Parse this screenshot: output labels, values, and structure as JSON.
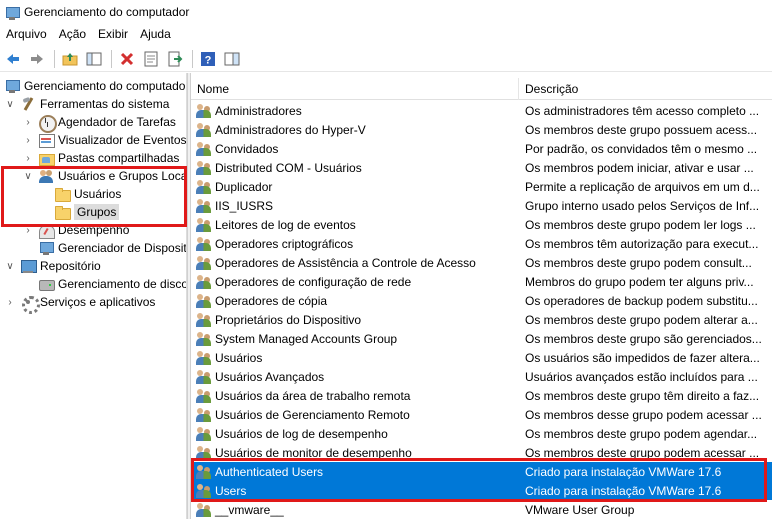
{
  "window": {
    "title": "Gerenciamento do computador"
  },
  "menu": [
    "Arquivo",
    "Ação",
    "Exibir",
    "Ajuda"
  ],
  "toolbar": {
    "buttons": [
      "back-arrow-icon",
      "forward-arrow-icon",
      "up-folder-icon",
      "show-hide-tree-icon",
      "delete-icon",
      "properties-icon",
      "export-list-icon",
      "help-icon",
      "console-view-icon"
    ]
  },
  "tree": {
    "root": "Gerenciamento do computador",
    "system_tools": "Ferramentas do sistema",
    "task_scheduler": "Agendador de Tarefas",
    "event_viewer": "Visualizador de Eventos",
    "shared_folders": "Pastas compartilhadas",
    "local_users_groups": "Usuários e Grupos Loca",
    "users": "Usuários",
    "groups": "Grupos",
    "performance": "Desempenho",
    "device_manager": "Gerenciador de Disposit",
    "storage": "Repositório",
    "disk_management": "Gerenciamento de disco",
    "services_apps": "Serviços e aplicativos"
  },
  "list": {
    "columns": {
      "name": "Nome",
      "description": "Descrição"
    },
    "rows": [
      {
        "name": "Administradores",
        "desc": "Os administradores têm acesso completo ..."
      },
      {
        "name": "Administradores do Hyper-V",
        "desc": "Os membros deste grupo possuem acess..."
      },
      {
        "name": "Convidados",
        "desc": "Por padrão, os convidados têm o mesmo ..."
      },
      {
        "name": "Distributed COM - Usuários",
        "desc": "Os membros podem iniciar, ativar e usar ..."
      },
      {
        "name": "Duplicador",
        "desc": "Permite a replicação de arquivos em um d..."
      },
      {
        "name": "IIS_IUSRS",
        "desc": "Grupo interno usado pelos Serviços de Inf..."
      },
      {
        "name": "Leitores de log de eventos",
        "desc": "Os membros deste grupo podem ler logs ..."
      },
      {
        "name": "Operadores criptográficos",
        "desc": "Os membros têm autorização para execut..."
      },
      {
        "name": "Operadores de Assistência a Controle de Acesso",
        "desc": "Os membros deste grupo podem consult..."
      },
      {
        "name": "Operadores de configuração de rede",
        "desc": "Membros do grupo podem ter alguns priv..."
      },
      {
        "name": "Operadores de cópia",
        "desc": "Os operadores de backup podem substitu..."
      },
      {
        "name": "Proprietários do Dispositivo",
        "desc": "Os membros deste grupo podem alterar a..."
      },
      {
        "name": "System Managed Accounts Group",
        "desc": "Os membros deste grupo são gerenciados..."
      },
      {
        "name": "Usuários",
        "desc": "Os usuários são impedidos de fazer altera..."
      },
      {
        "name": "Usuários Avançados",
        "desc": "Usuários avançados estão incluídos para ..."
      },
      {
        "name": "Usuários da área de trabalho remota",
        "desc": "Os membros deste grupo têm direito a faz..."
      },
      {
        "name": "Usuários de Gerenciamento Remoto",
        "desc": "Os membros desse grupo podem acessar ..."
      },
      {
        "name": "Usuários de log de desempenho",
        "desc": "Os membros deste grupo podem agendar..."
      },
      {
        "name": "Usuários de monitor de desempenho",
        "desc": "Os membros deste grupo podem acessar ..."
      },
      {
        "name": "Authenticated Users",
        "desc": "Criado para instalação VMWare 17.6"
      },
      {
        "name": "Users",
        "desc": "Criado para instalação VMWare 17.6"
      },
      {
        "name": "__vmware__",
        "desc": "VMware User Group"
      }
    ]
  },
  "colors": {
    "selection": "#0078d7",
    "highlight": "#e01919"
  }
}
